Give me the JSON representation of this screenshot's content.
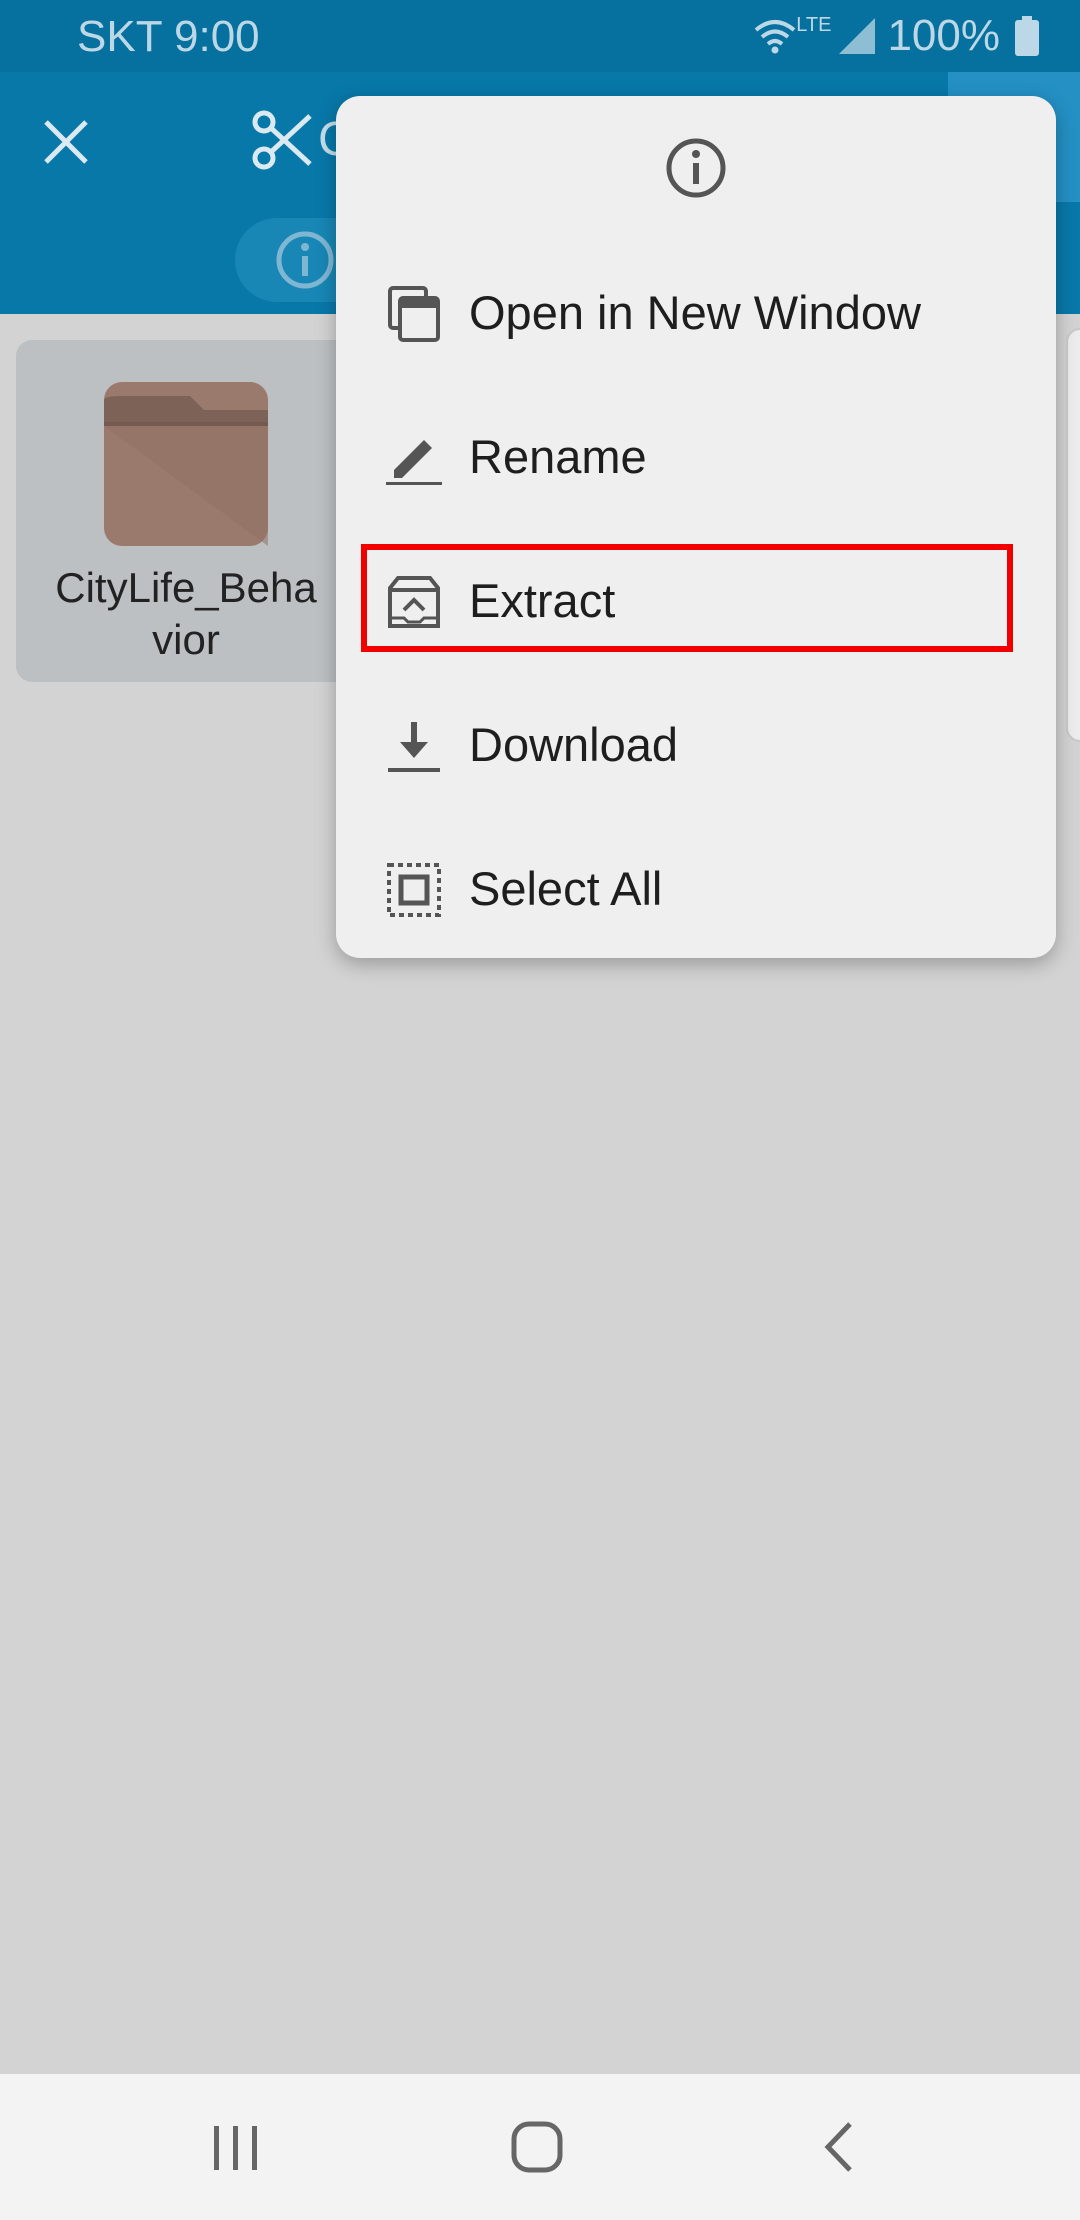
{
  "status_bar": {
    "carrier_time": "SKT 9:00",
    "network": "LTE",
    "battery": "100%"
  },
  "toolbar": {
    "title_partial": "C",
    "close_icon": "close-icon",
    "cut_icon": "scissors-icon",
    "info_icon": "info-icon"
  },
  "files": [
    {
      "name": "CityLife_Behavior",
      "name_line1": "CityLife_Beha",
      "name_line2": "vior",
      "icon": "folder-icon"
    }
  ],
  "context_menu": {
    "header_icon": "info-icon",
    "items": [
      {
        "label": "Open in New Window",
        "icon": "new-window-icon"
      },
      {
        "label": "Rename",
        "icon": "pencil-icon"
      },
      {
        "label": "Extract",
        "icon": "archive-icon",
        "highlighted": true
      },
      {
        "label": "Download",
        "icon": "download-icon"
      },
      {
        "label": "Select All",
        "icon": "select-all-icon"
      }
    ]
  },
  "colors": {
    "status_bar": "#06709e",
    "toolbar": "#0878a9",
    "highlight": "#f20000",
    "folder": "#9a7a6d"
  },
  "nav_bar": {
    "recents_icon": "recents-icon",
    "home_icon": "home-icon",
    "back_icon": "back-icon"
  }
}
